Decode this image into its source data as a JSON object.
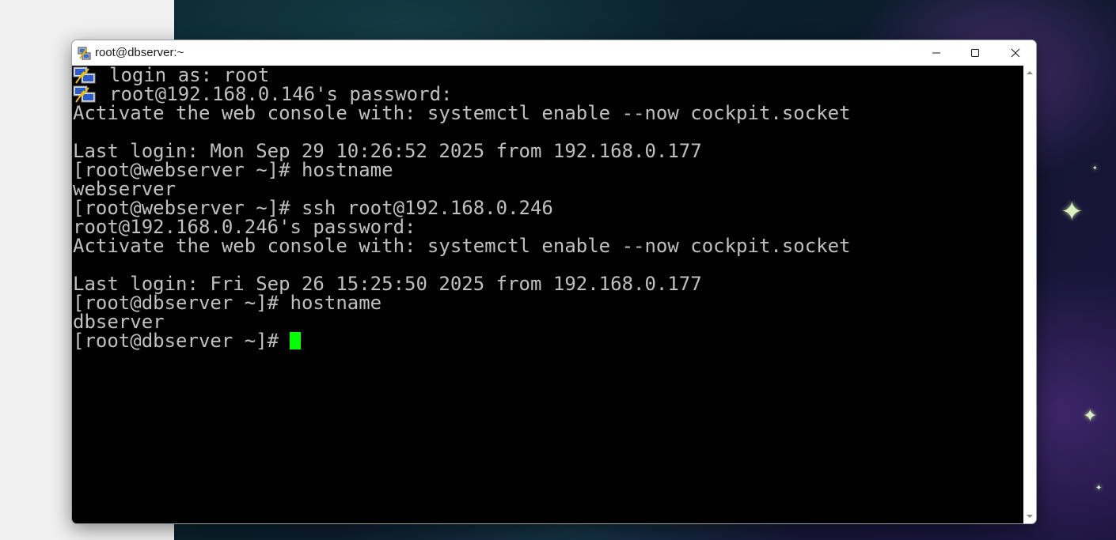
{
  "window": {
    "title": "root@dbserver:~",
    "app_icon": "putty-icon",
    "controls": {
      "minimize": "minimize-icon",
      "maximize": "maximize-icon",
      "close": "close-icon"
    }
  },
  "terminal": {
    "lines": [
      {
        "text": "login as: root",
        "icon": "putty-icon"
      },
      {
        "text": "root@192.168.0.146's password:",
        "icon": "putty-icon"
      },
      {
        "text": "Activate the web console with: systemctl enable --now cockpit.socket"
      },
      {
        "text": ""
      },
      {
        "text": "Last login: Mon Sep 29 10:26:52 2025 from 192.168.0.177"
      },
      {
        "text": "[root@webserver ~]# hostname"
      },
      {
        "text": "webserver"
      },
      {
        "text": "[root@webserver ~]# ssh root@192.168.0.246"
      },
      {
        "text": "root@192.168.0.246's password:"
      },
      {
        "text": "Activate the web console with: systemctl enable --now cockpit.socket"
      },
      {
        "text": ""
      },
      {
        "text": "Last login: Fri Sep 26 15:25:50 2025 from 192.168.0.177"
      },
      {
        "text": "[root@dbserver ~]# hostname"
      },
      {
        "text": "dbserver"
      }
    ],
    "prompt": "[root@dbserver ~]#",
    "text_color": "#c0c0c0",
    "background": "#000000",
    "cursor_color": "#00ff00"
  }
}
